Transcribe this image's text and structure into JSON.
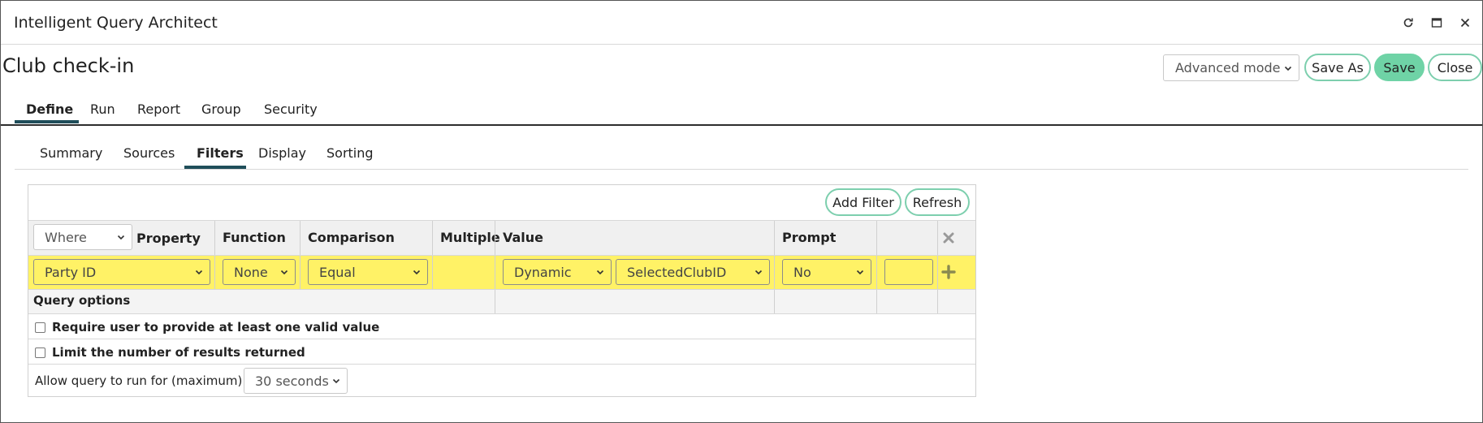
{
  "window": {
    "title": "Intelligent Query Architect",
    "controls": [
      "refresh-icon",
      "maximize-icon",
      "close-icon"
    ]
  },
  "page": {
    "heading": "Club check-in"
  },
  "toolbar": {
    "mode_select": "Advanced mode",
    "save_as_label": "Save As",
    "save_label": "Save",
    "close_label": "Close"
  },
  "tabs": [
    {
      "label": "Define",
      "active": true
    },
    {
      "label": "Run"
    },
    {
      "label": "Report"
    },
    {
      "label": "Group"
    },
    {
      "label": "Security"
    }
  ],
  "subtabs": [
    {
      "label": "Summary"
    },
    {
      "label": "Sources"
    },
    {
      "label": "Filters",
      "active": true
    },
    {
      "label": "Display"
    },
    {
      "label": "Sorting"
    }
  ],
  "filters": {
    "add_filter_label": "Add Filter",
    "refresh_label": "Refresh",
    "where_select": "Where",
    "columns": {
      "property": "Property",
      "function": "Function",
      "comparison": "Comparison",
      "multiple": "Multiple",
      "value": "Value",
      "prompt": "Prompt"
    },
    "rows": [
      {
        "property": "Party ID",
        "function": "None",
        "comparison": "Equal",
        "multiple": "",
        "value_type": "Dynamic",
        "value": "SelectedClubID",
        "prompt": "No",
        "extra": ""
      }
    ],
    "row_highlight_color": "#fff266"
  },
  "query_options": {
    "title": "Query options",
    "require_valid_value": {
      "label": "Require user to provide at least one valid value",
      "checked": false
    },
    "limit_results": {
      "label": "Limit the number of results returned",
      "checked": false
    },
    "max_run_label": "Allow query to run for (maximum)",
    "max_run_value": "30 seconds"
  },
  "colors": {
    "accent_border": "#7dcfae",
    "save_fill": "#6fd3a6",
    "tab_underline": "#1f4e5a"
  }
}
